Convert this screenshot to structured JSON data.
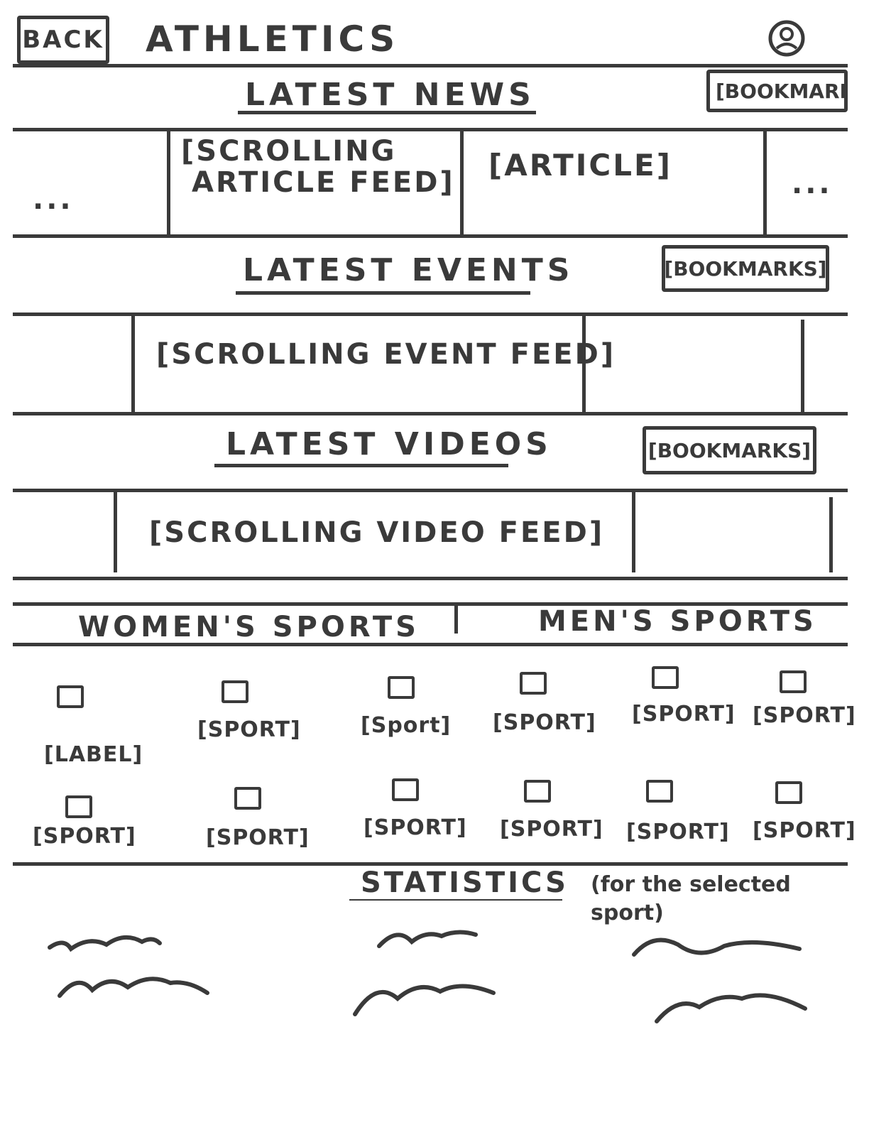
{
  "header": {
    "back_label": "BACK",
    "title": "ATHLETICS",
    "profile_icon": "user-icon"
  },
  "news": {
    "title": "LATEST NEWS",
    "bookmarks_label": "[BOOKMARKS]",
    "feed_label_line1": "[SCROLLING",
    "feed_label_line2": "ARTICLE FEED]",
    "article_label": "[ARTICLE]",
    "ellipsis": "..."
  },
  "events": {
    "title": "LATEST EVENTS",
    "bookmarks_label": "[BOOKMARKS]",
    "feed_label": "[SCROLLING EVENT FEED]"
  },
  "videos": {
    "title": "LATEST VIDEOS",
    "bookmarks_label": "[BOOKMARKS]",
    "feed_label": "[SCROLLING VIDEO FEED]"
  },
  "categories": {
    "womens": "WOMEN'S SPORTS",
    "mens": "MEN'S SPORTS"
  },
  "sports": {
    "row1": [
      "[LABEL]",
      "[SPORT]",
      "[Sport]",
      "[SPORT]",
      "[SPORT]",
      "[SPORT]"
    ],
    "row2": [
      "[SPORT]",
      "[SPORT]",
      "[SPORT]",
      "[SPORT]",
      "[SPORT]",
      "[SPORT]"
    ]
  },
  "statistics": {
    "title": "STATISTICS",
    "note": "(for the selected sport)"
  }
}
